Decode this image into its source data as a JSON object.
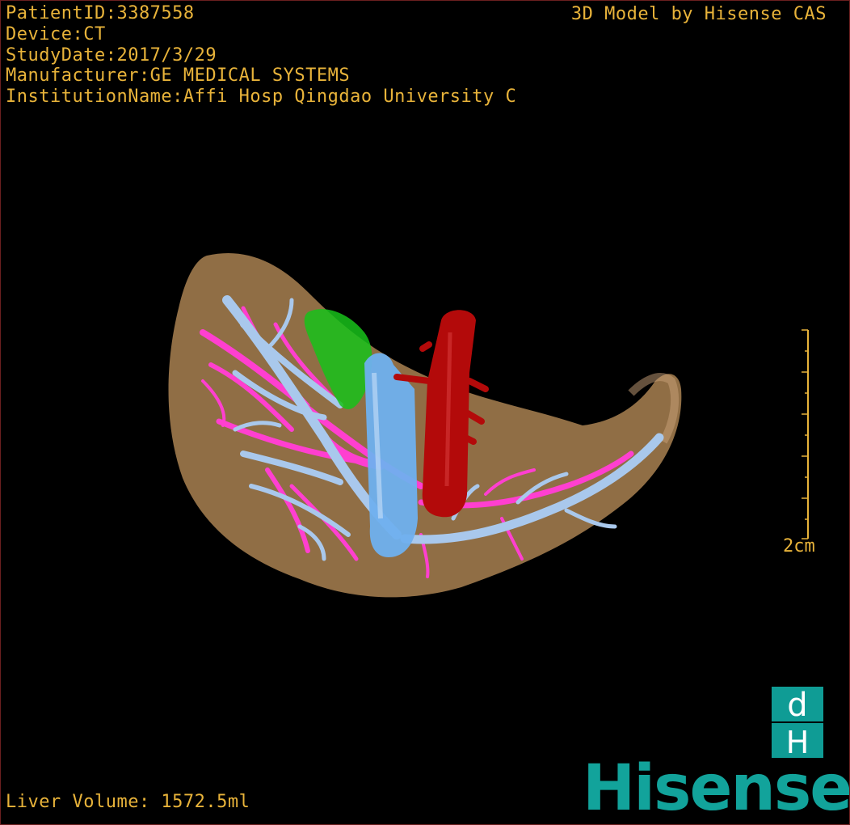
{
  "patient_info": {
    "lines": [
      "PatientID:3387558",
      "Device:CT",
      "StudyDate:2017/3/29",
      "Manufacturer:GE MEDICAL SYSTEMS",
      "InstitutionName:Affi Hosp Qingdao University C"
    ]
  },
  "credit": "3D Model by Hisense CAS",
  "scale": {
    "label": "2cm"
  },
  "volume": "Liver Volume: 1572.5ml",
  "brand": {
    "mark": "dH",
    "name": "Hisense"
  },
  "colors": {
    "text": "#e8b33a",
    "liver": "#a07a4c",
    "portal_vein": "#a9c8ec",
    "hepatic_vein": "#ff3fd0",
    "gallbladder": "#18c21a",
    "ivc": "#6fb0ef",
    "aorta": "#b30a0a",
    "brand": "#12a39b"
  }
}
